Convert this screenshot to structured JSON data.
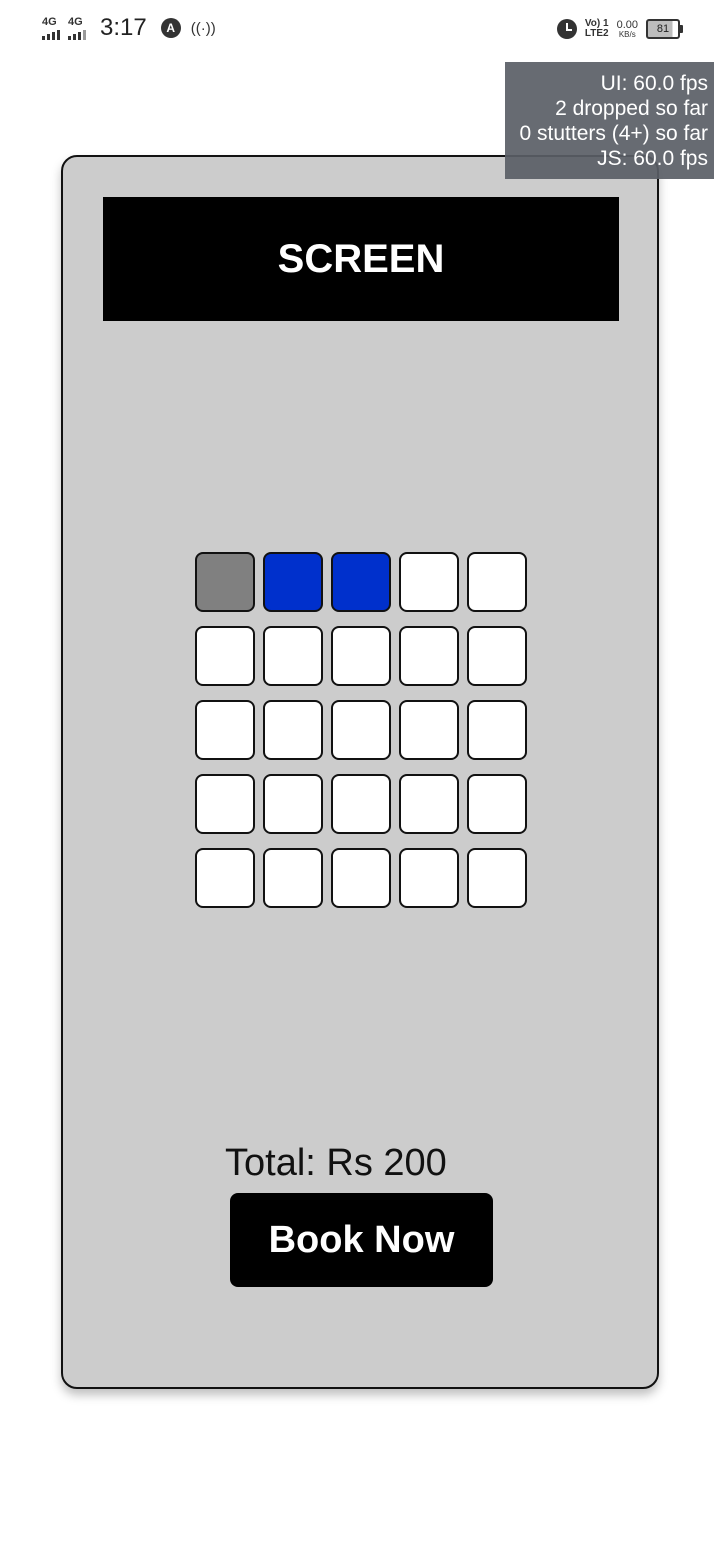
{
  "status_bar": {
    "network_1": "4G",
    "network_2": "4G",
    "time": "3:17",
    "app_icon": "A",
    "hotspot_icon": "((·))",
    "volte_line1": "Vo) 1",
    "volte_line2": "LTE2",
    "data_speed_value": "0.00",
    "data_speed_unit": "KB/s",
    "battery_level": "81"
  },
  "perf_monitor": {
    "ui_fps": "UI: 60.0 fps",
    "dropped": "2 dropped so far",
    "stutters": "0 stutters (4+) so far",
    "js_fps": "JS: 60.0 fps"
  },
  "booking": {
    "screen_label": "SCREEN",
    "seats": [
      [
        "booked",
        "selected",
        "selected",
        "available",
        "available"
      ],
      [
        "available",
        "available",
        "available",
        "available",
        "available"
      ],
      [
        "available",
        "available",
        "available",
        "available",
        "available"
      ],
      [
        "available",
        "available",
        "available",
        "available",
        "available"
      ],
      [
        "available",
        "available",
        "available",
        "available",
        "available"
      ]
    ],
    "seat_colors": {
      "booked": "#808080",
      "selected": "#0030cc",
      "available": "#ffffff"
    },
    "total_text": "Total: Rs 200",
    "book_button_label": "Book Now"
  },
  "colors": {
    "card_background": "#cccccc",
    "screen_background": "#000000",
    "button_background": "#000000"
  }
}
